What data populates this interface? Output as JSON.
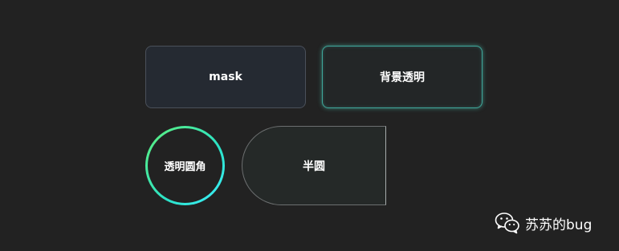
{
  "buttons": {
    "mask_label": "mask",
    "transparent_bg_label": "背景透明",
    "transparent_round_label": "透明圆角",
    "half_circle_label": "半圆"
  },
  "watermark": {
    "text": "苏苏的bug",
    "icon": "wechat-icon"
  },
  "colors": {
    "background": "#222222",
    "accent_teal": "#3fa69a",
    "accent_green": "#5ff07a",
    "accent_cyan": "#2be2c8"
  }
}
